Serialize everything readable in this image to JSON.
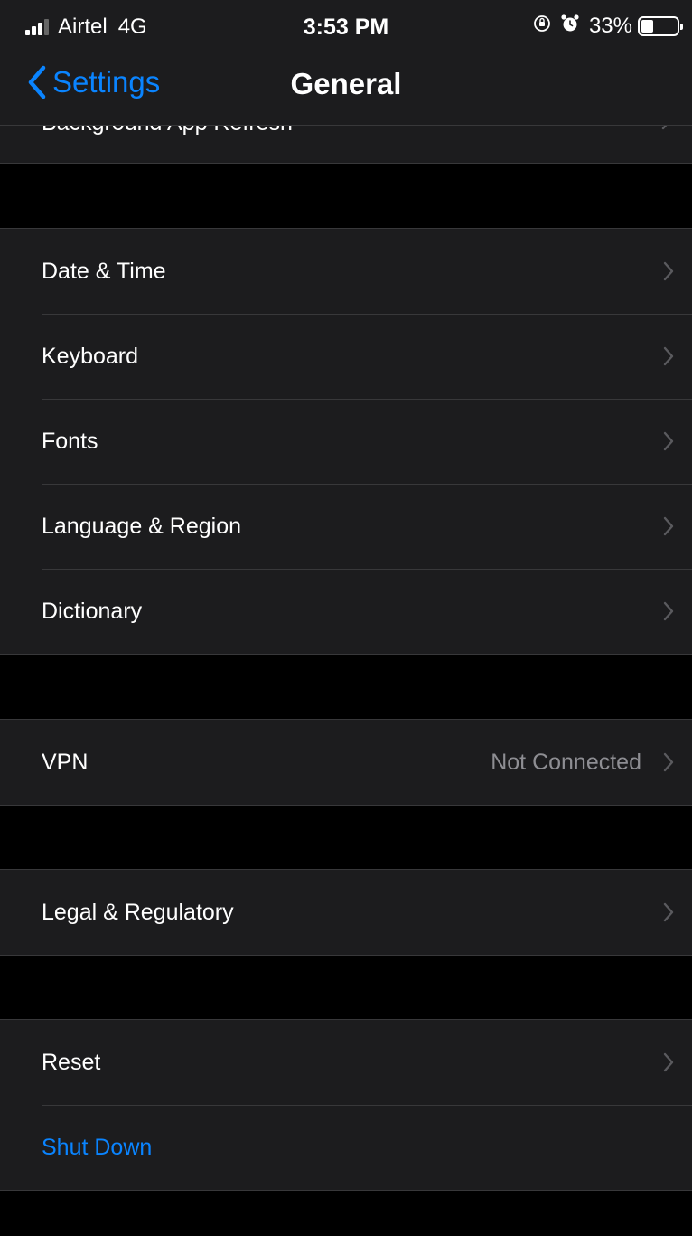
{
  "status_bar": {
    "carrier": "Airtel",
    "network": "4G",
    "time": "3:53 PM",
    "battery_percent": "33%",
    "battery_level": 0.33
  },
  "nav": {
    "back_label": "Settings",
    "title": "General"
  },
  "clipped_row": {
    "label": "Background App Refresh"
  },
  "group1": {
    "items": [
      {
        "label": "Date & Time"
      },
      {
        "label": "Keyboard"
      },
      {
        "label": "Fonts"
      },
      {
        "label": "Language & Region"
      },
      {
        "label": "Dictionary"
      }
    ]
  },
  "group2": {
    "items": [
      {
        "label": "VPN",
        "value": "Not Connected"
      }
    ]
  },
  "group3": {
    "items": [
      {
        "label": "Legal & Regulatory"
      }
    ]
  },
  "group4": {
    "items": [
      {
        "label": "Reset"
      },
      {
        "label": "Shut Down"
      }
    ]
  },
  "colors": {
    "accent": "#0a84ff",
    "cell_background": "#1c1c1e",
    "page_background": "#000000",
    "separator": "#38383a",
    "secondary_text": "#8e8e93"
  }
}
